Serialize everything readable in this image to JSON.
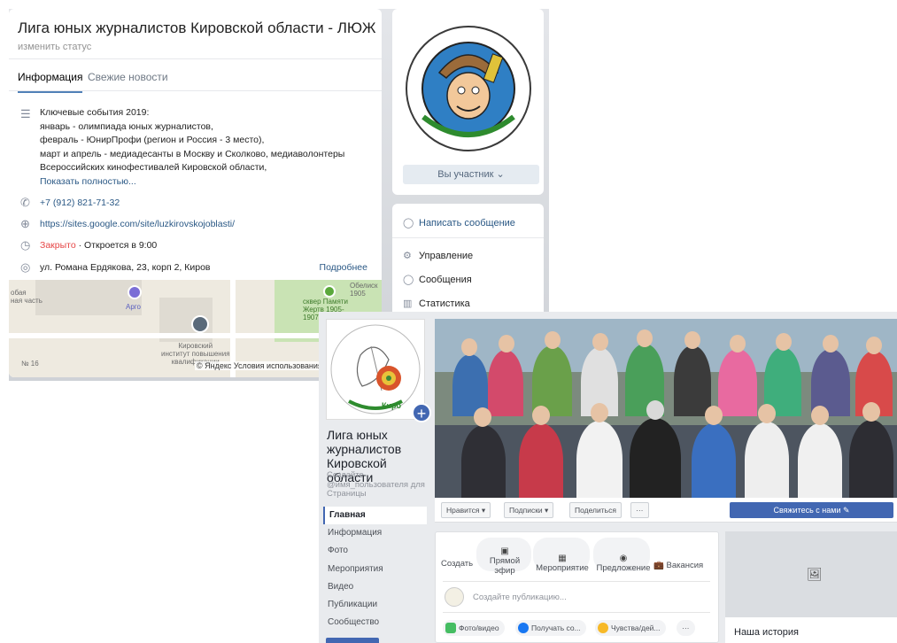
{
  "vk": {
    "title": "Лига юных журналистов Кировской области - ЛЮЖ",
    "status": "изменить статус",
    "tabs": [
      "Информация",
      "Свежие новости"
    ],
    "description": [
      "Ключевые события 2019:",
      "январь - олимпиада юных журналистов,",
      "февраль - ЮнирПрофи (регион и Россия - 3 место),",
      "март и апрель - медиадесанты в Москву и Сколково, медиаволонтеры",
      "Всероссийских кинофестивалей Кировской области,"
    ],
    "show_more": "Показать полностью...",
    "phone": "+7 (912) 821-71-32",
    "website": "https://sites.google.com/site/luzkirovskojoblasti/",
    "closed": "Закрыто",
    "opens": "· Откроется в 9:00",
    "address": "ул. Романа Ердякова, 23, корп 2, Киров",
    "details": "Подробнее",
    "map": {
      "labels": [
        "Арго",
        "сквер Памяти\nЖертв 1905-\n1907",
        "Кировский\nинститут повышения\nквалификации",
        "обая\nная часть",
        "№ 16",
        "Обелиск\n1905"
      ],
      "copyright": "© Яндекс Условия использования"
    },
    "member_button": "Вы участник ⌄",
    "actions": [
      "Написать сообщение",
      "Управление",
      "Сообщения",
      "Статистика"
    ],
    "colors": {
      "link": "#2a5885",
      "closed": "#e64646",
      "accent": "#5181b8"
    }
  },
  "fb": {
    "page_name": "Лига юных журналистов Кировской области",
    "username_prompt": "Создайте @имя_пользователя для Страницы",
    "nav": [
      "Главная",
      "Информация",
      "Фото",
      "Мероприятия",
      "Видео",
      "Публикации",
      "Сообщество"
    ],
    "action_buttons": [
      "Нравится ▾",
      "Подписки ▾",
      "Поделиться",
      "···"
    ],
    "contact_button": "Свяжитесь с нами ✎",
    "post_types": [
      "Создать",
      "Прямой эфир",
      "Мероприятие",
      "Предложение",
      "Вакансия"
    ],
    "compose_placeholder": "Создайте публикацию...",
    "chips": [
      "Фото/видео",
      "Получать со...",
      "Чувства/дей...",
      "···"
    ],
    "side_title": "Наша история",
    "colors": {
      "brand": "#4267b2",
      "background": "#e9ebee"
    }
  }
}
